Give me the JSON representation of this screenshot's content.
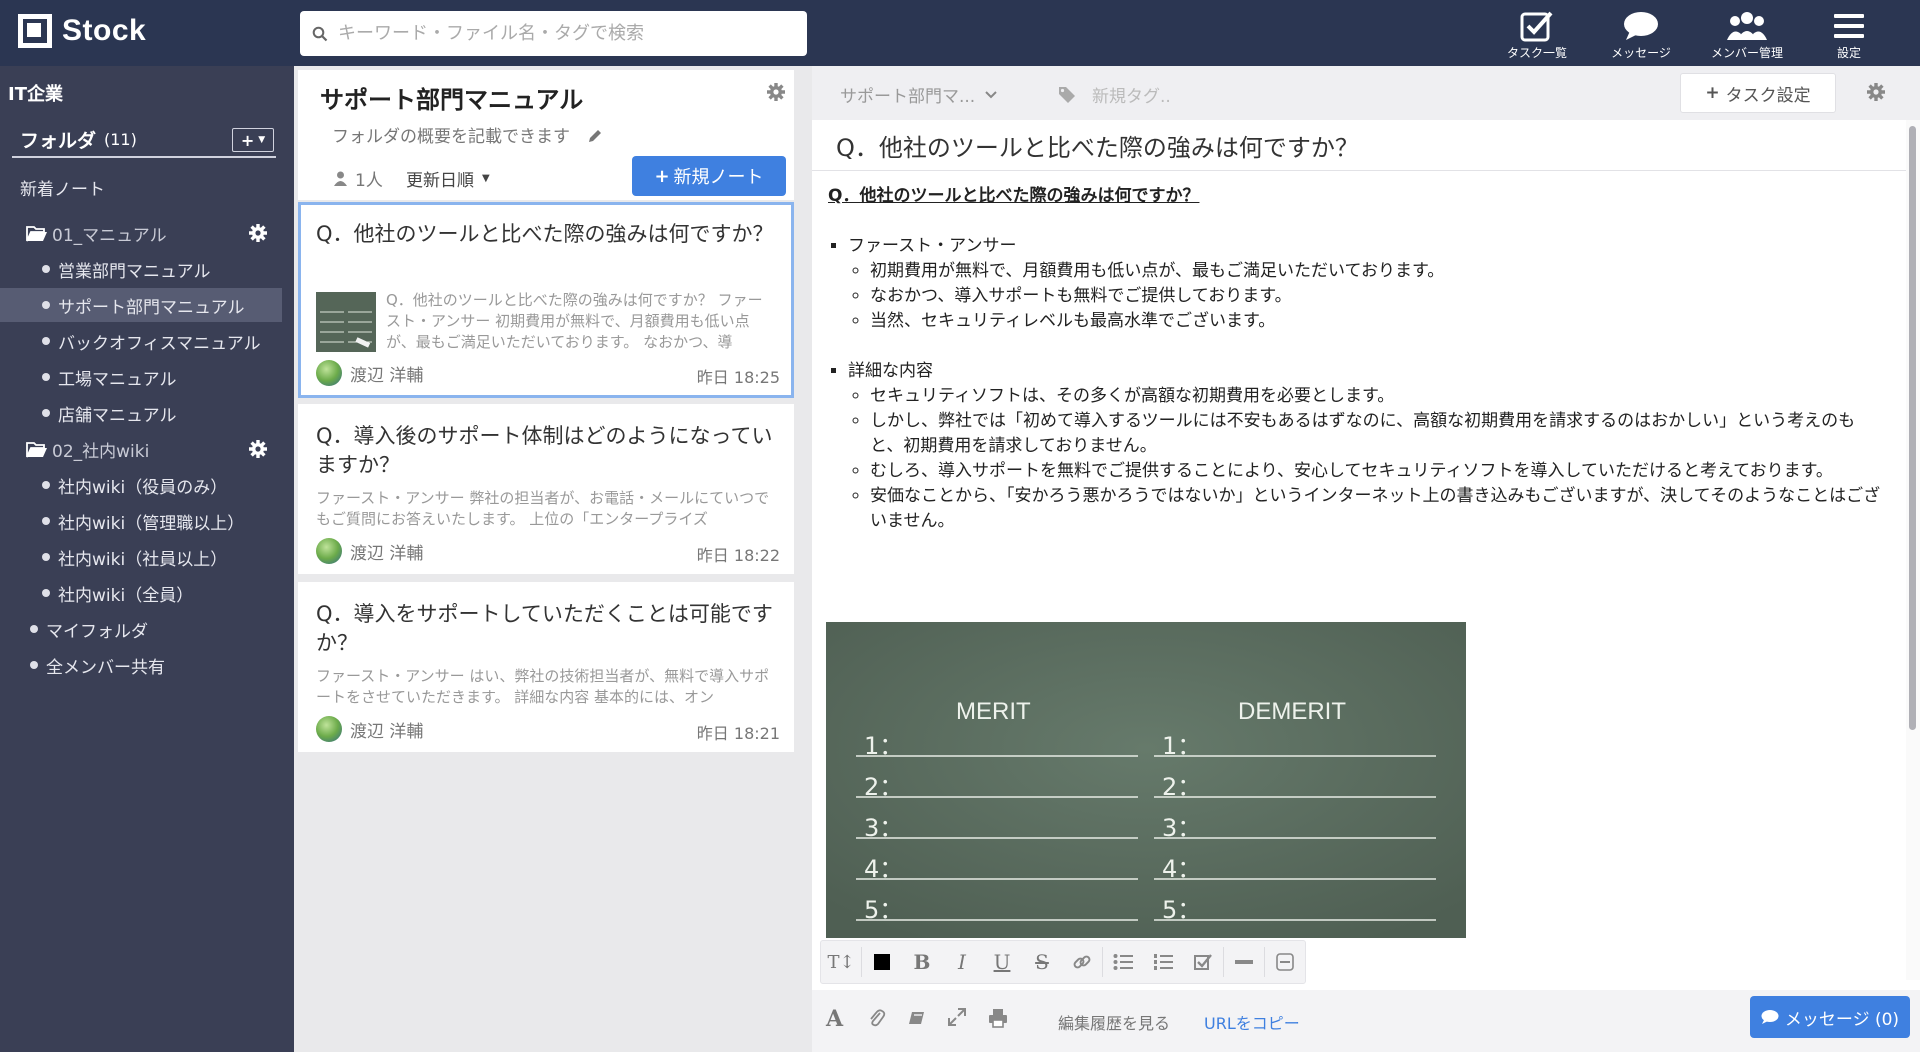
{
  "app": {
    "name": "Stock"
  },
  "search": {
    "placeholder": "キーワード・ファイル名・タグで検索"
  },
  "nav": [
    {
      "label": "タスク一覧",
      "icon": "task-check-icon"
    },
    {
      "label": "メッセージ",
      "icon": "speech-bubble-icon"
    },
    {
      "label": "メンバー管理",
      "icon": "members-icon"
    },
    {
      "label": "設定",
      "icon": "hamburger-menu-icon"
    }
  ],
  "sidebar": {
    "company": "IT企業",
    "folder_label": "フォルダ",
    "folder_count": "(11)",
    "new_notes": "新着ノート",
    "groups": [
      {
        "name": "01_マニュアル",
        "items": [
          "営業部門マニュアル",
          "サポート部門マニュアル",
          "バックオフィスマニュアル",
          "工場マニュアル",
          "店舗マニュアル"
        ]
      },
      {
        "name": "02_社内wiki",
        "items": [
          "社内wiki（役員のみ）",
          "社内wiki（管理職以上）",
          "社内wiki（社員以上）",
          "社内wiki（全員）"
        ]
      }
    ],
    "my_folder": "マイフォルダ",
    "all_shared": "全メンバー共有"
  },
  "folder": {
    "title": "サポート部門マニュアル",
    "description": "フォルダの概要を記載できます",
    "members": "1人",
    "sort": "更新日順",
    "new_note": "新規ノート"
  },
  "notes": [
    {
      "title": "Q．他社のツールと比べた際の強みは何ですか？",
      "excerpt": "Q．他社のツールと比べた際の強みは何ですか？ ファースト・アンサー 初期費用が無料で、月額費用も低い点が、最もご満足いただいております。 なおかつ、導",
      "author": "渡辺 洋輔",
      "date": "昨日 18:25"
    },
    {
      "title": "Q．導入後のサポート体制はどのようになっていますか？",
      "excerpt": "ファースト・アンサー 弊社の担当者が、お電話・メールにていつでもご質問にお答えいたします。 上位の「エンタープライズ",
      "author": "渡辺 洋輔",
      "date": "昨日 18:22"
    },
    {
      "title": "Q．導入をサポートしていただくことは可能ですか？",
      "excerpt": "ファースト・アンサー はい、弊社の技術担当者が、無料で導入サポートをさせていただきます。 詳細な内容 基本的には、オン",
      "author": "渡辺 洋輔",
      "date": "昨日 18:21"
    }
  ],
  "editor": {
    "folder": "サポート部門マ...",
    "tag_placeholder": "新規タグ..",
    "task_button": "タスク設定",
    "title": "Q．他社のツールと比べた際の強みは何ですか？",
    "heading": "Q．他社のツールと比べた際の強みは何ですか？",
    "section1": "ファースト・アンサー",
    "section1_items": [
      "初期費用が無料で、月額費用も低い点が、最もご満足いただいております。",
      "なおかつ、導入サポートも無料でご提供しております。",
      "当然、セキュリティレベルも最高水準でございます。"
    ],
    "section2": "詳細な内容",
    "section2_items": [
      "セキュリティソフトは、その多くが高額な初期費用を必要とします。",
      "しかし、弊社では「初めて導入するツールには不安もあるはずなのに、高額な初期費用を請求するのはおかしい」という考えのもと、初期費用を請求しておりません。",
      "むしろ、導入サポートを無料でご提供することにより、安心してセキュリティソフトを導入していただけると考えております。",
      "安価なことから、「安かろう悪かろうではないか」というインターネット上の書き込みもございますが、決してそのようなことはございません。"
    ],
    "board": {
      "merit": "MERIT",
      "demerit": "DEMERIT",
      "rows": [
        "1：",
        "2：",
        "3：",
        "4：",
        "5："
      ]
    },
    "toolbar": {
      "text_size": "T↕",
      "bold": "B",
      "italic": "I",
      "underline": "U",
      "strike": "S"
    },
    "bottom": {
      "history": "編集履歴を見る",
      "copy_url": "URLをコピー",
      "message": "メッセージ (0)"
    }
  },
  "colors": {
    "topbar": "#2b3652",
    "sidebar": "#3a3f55",
    "accent": "#3f80e0"
  }
}
